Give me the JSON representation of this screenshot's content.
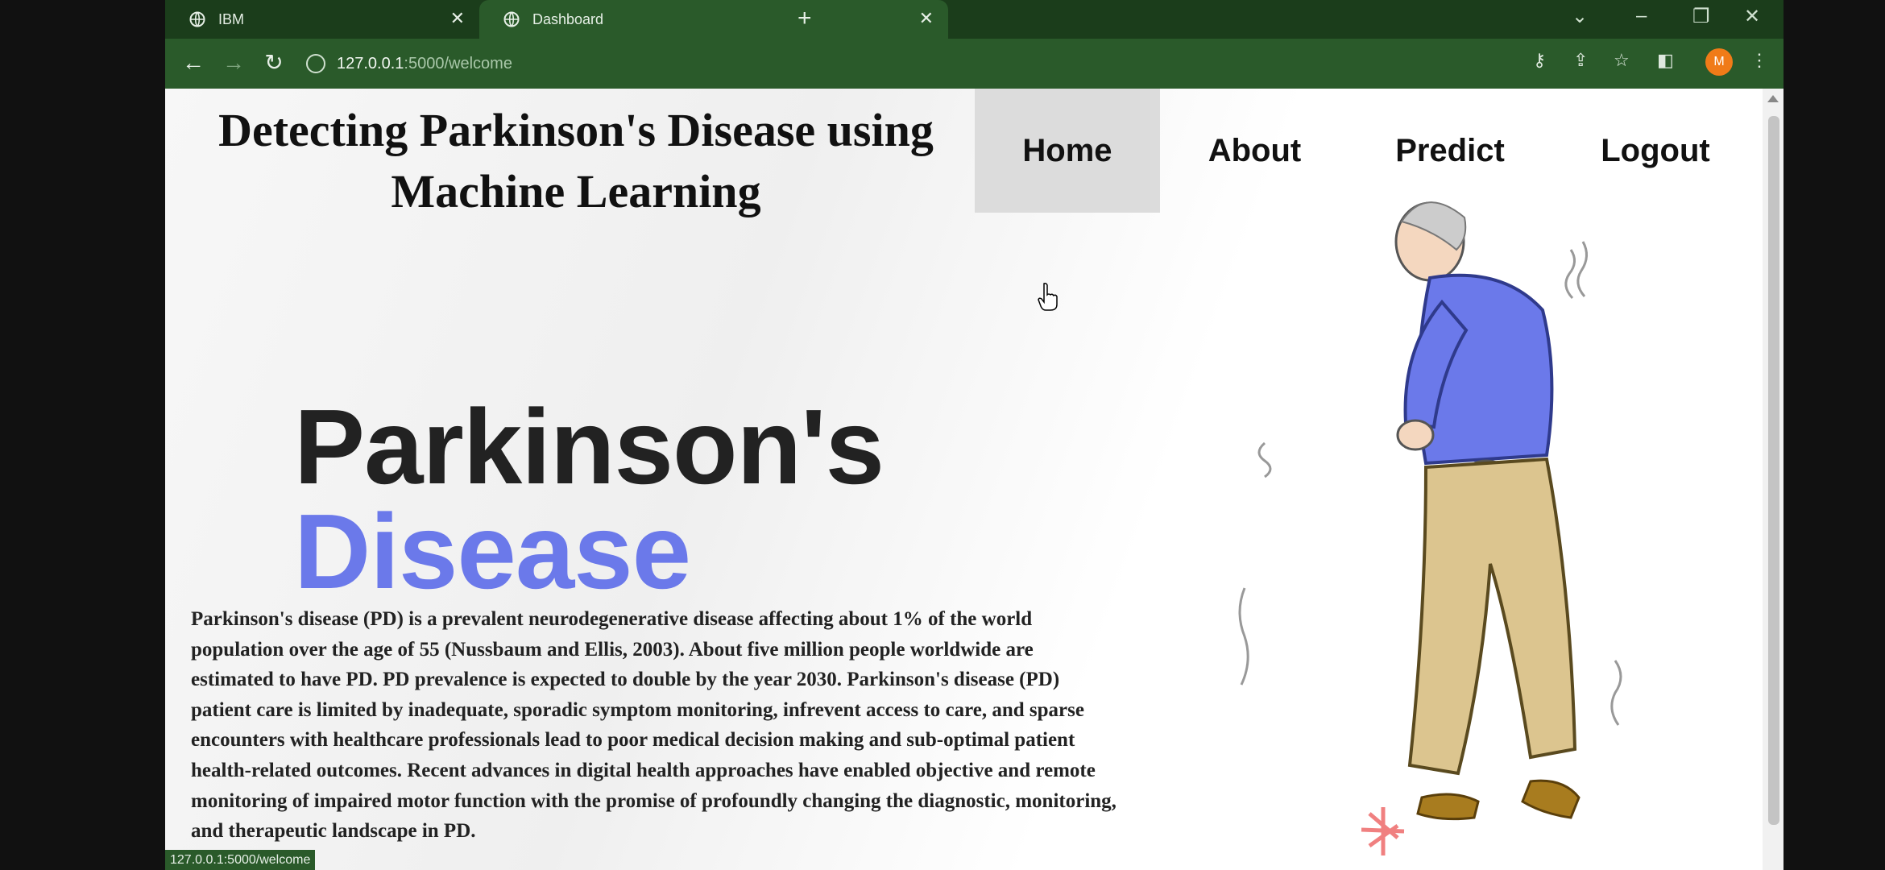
{
  "browser": {
    "tabs": [
      {
        "label": "IBM"
      },
      {
        "label": "Dashboard"
      }
    ],
    "url_host": "127.0.0.1",
    "url_path": ":5000/welcome",
    "avatar_initial": "M",
    "status_url": "127.0.0.1:5000/welcome",
    "colors": {
      "frame": "#1b3d1b",
      "toolbar": "#2a5a2a",
      "avatar": "#f07b18"
    }
  },
  "site": {
    "title": "Detecting Parkinson's Disease using Machine Learning",
    "nav": {
      "home": "Home",
      "about": "About",
      "predict": "Predict",
      "logout": "Logout"
    },
    "hero_line1": "Parkinson's",
    "hero_line2": "Disease",
    "hero_accent": "#6b79ea",
    "description": "Parkinson's disease (PD) is a prevalent neurodegenerative disease affecting about 1% of the world population over the age of 55 (Nussbaum and Ellis, 2003). About five million people worldwide are estimated to have PD. PD prevalence is expected to double by the year 2030. Parkinson's disease (PD) patient care is limited by inadequate, sporadic symptom monitoring, infrevent access to care, and sparse encounters with healthcare professionals lead to poor medical decision making and sub-optimal patient health-related outcomes. Recent advances in digital health approaches have enabled objective and remote monitoring of impaired motor function with the promise of profoundly changing the diagnostic, monitoring, and therapeutic landscape in PD."
  }
}
